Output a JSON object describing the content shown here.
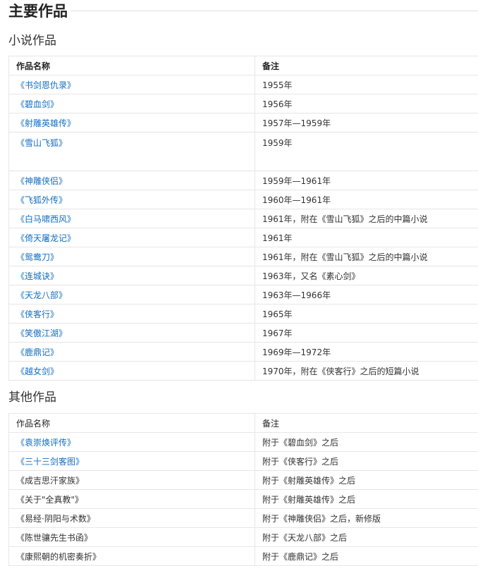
{
  "page": {
    "title": "主要作品"
  },
  "novels": {
    "heading": "小说作品",
    "columns": [
      "作品名称",
      "备注"
    ],
    "rows": [
      {
        "name": "《书剑恩仇录》",
        "note": "1955年",
        "linked": true
      },
      {
        "name": "《碧血剑》",
        "note": "1956年",
        "linked": true
      },
      {
        "name": "《射雕英雄传》",
        "note": "1957年—1959年",
        "linked": true
      },
      {
        "name": "《雪山飞狐》",
        "note": "1959年",
        "linked": true
      },
      {
        "name": "《神雕侠侣》",
        "note": "1959年—1961年",
        "linked": true
      },
      {
        "name": "《飞狐外传》",
        "note": "1960年—1961年",
        "linked": true
      },
      {
        "name": "《白马啸西风》",
        "note": "1961年，附在《雪山飞狐》之后的中篇小说",
        "linked": true
      },
      {
        "name": "《倚天屠龙记》",
        "note": "1961年",
        "linked": true
      },
      {
        "name": "《鸳鸯刀》",
        "note": "1961年，附在《雪山飞狐》之后的中篇小说",
        "linked": true
      },
      {
        "name": "《连城诀》",
        "note": "1963年，又名《素心剑》",
        "linked": true
      },
      {
        "name": "《天龙八部》",
        "note": "1963年—1966年",
        "linked": true
      },
      {
        "name": "《侠客行》",
        "note": "1965年",
        "linked": true
      },
      {
        "name": "《笑傲江湖》",
        "note": "1967年",
        "linked": true
      },
      {
        "name": "《鹿鼎记》",
        "note": "1969年—1972年",
        "linked": true
      },
      {
        "name": "《越女剑》",
        "note": "1970年，附在《侠客行》之后的短篇小说",
        "linked": true
      }
    ]
  },
  "other": {
    "heading": "其他作品",
    "columns": [
      "作品名称",
      "备注"
    ],
    "rows": [
      {
        "name": "《袁崇焕评传》",
        "note": "附于《碧血剑》之后",
        "linked": true
      },
      {
        "name": "《三十三剑客图》",
        "note": "附于《侠客行》之后",
        "linked": true
      },
      {
        "name": "《成吉思汗家族》",
        "note": "附于《射雕英雄传》之后",
        "linked": false
      },
      {
        "name": "《关于\"全真教\"》",
        "note": "附于《射雕英雄传》之后",
        "linked": false
      },
      {
        "name": "《易经·阴阳与术数》",
        "note": "附于《神雕侠侣》之后，新修版",
        "linked": false
      },
      {
        "name": "《陈世骧先生书函》",
        "note": "附于《天龙八部》之后",
        "linked": false
      },
      {
        "name": "《康熙朝的机密奏折》",
        "note": "附于《鹿鼎记》之后",
        "linked": false
      }
    ]
  },
  "colors": {
    "link": "#136ec2",
    "text": "#333333",
    "border": "#e6e6e6"
  }
}
